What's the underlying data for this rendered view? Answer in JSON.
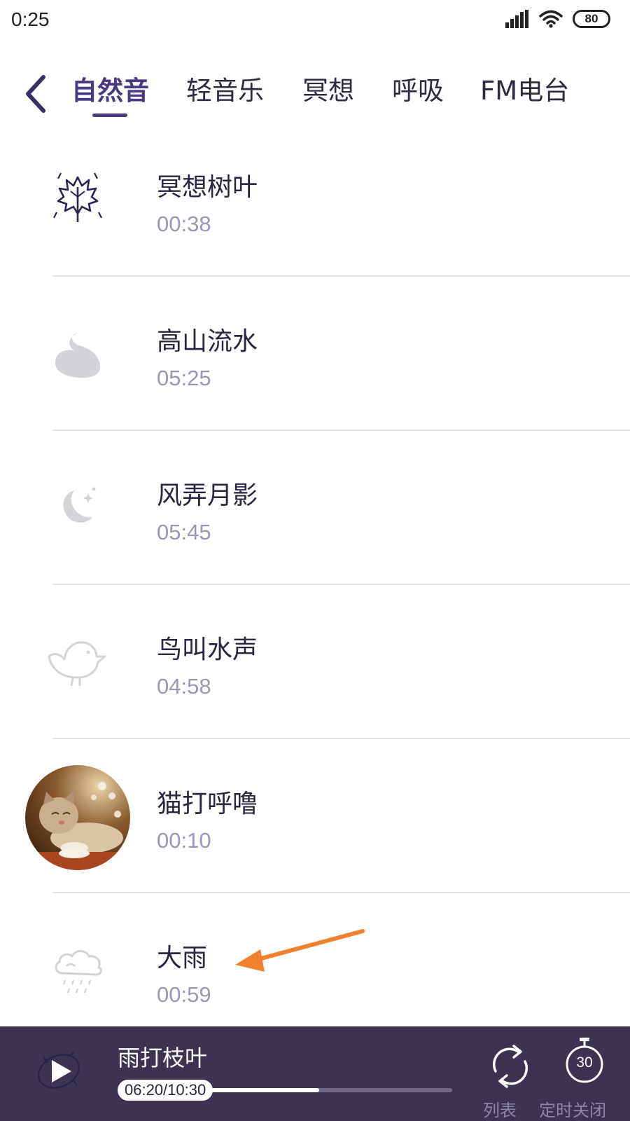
{
  "status_bar": {
    "time": "0:25",
    "battery": "80"
  },
  "tabs": [
    {
      "label": "自然音",
      "active": true
    },
    {
      "label": "轻音乐"
    },
    {
      "label": "冥想"
    },
    {
      "label": "呼吸"
    },
    {
      "label": "FM电台"
    }
  ],
  "tracks": [
    {
      "title": "冥想树叶",
      "duration": "00:38",
      "icon": "leaf-icon"
    },
    {
      "title": "高山流水",
      "duration": "05:25",
      "icon": "water-drop-icon"
    },
    {
      "title": "风弄月影",
      "duration": "05:45",
      "icon": "moon-icon"
    },
    {
      "title": "鸟叫水声",
      "duration": "04:58",
      "icon": "bird-icon"
    },
    {
      "title": "猫打呼噜",
      "duration": "00:10",
      "icon": "cat-photo"
    },
    {
      "title": "大雨",
      "duration": "00:59",
      "icon": "rain-cloud-icon"
    }
  ],
  "player": {
    "title": "雨打枝叶",
    "elapsed": "06:20/10:30",
    "progress": 0.603,
    "loop_label": "列表",
    "timer_label": "定时关闭",
    "timer_minutes": "30"
  },
  "colors": {
    "accent": "#4a3a82",
    "player_bg": "#3b3350",
    "duration_text": "#9a96b4",
    "annotation_arrow": "#f0822f"
  }
}
